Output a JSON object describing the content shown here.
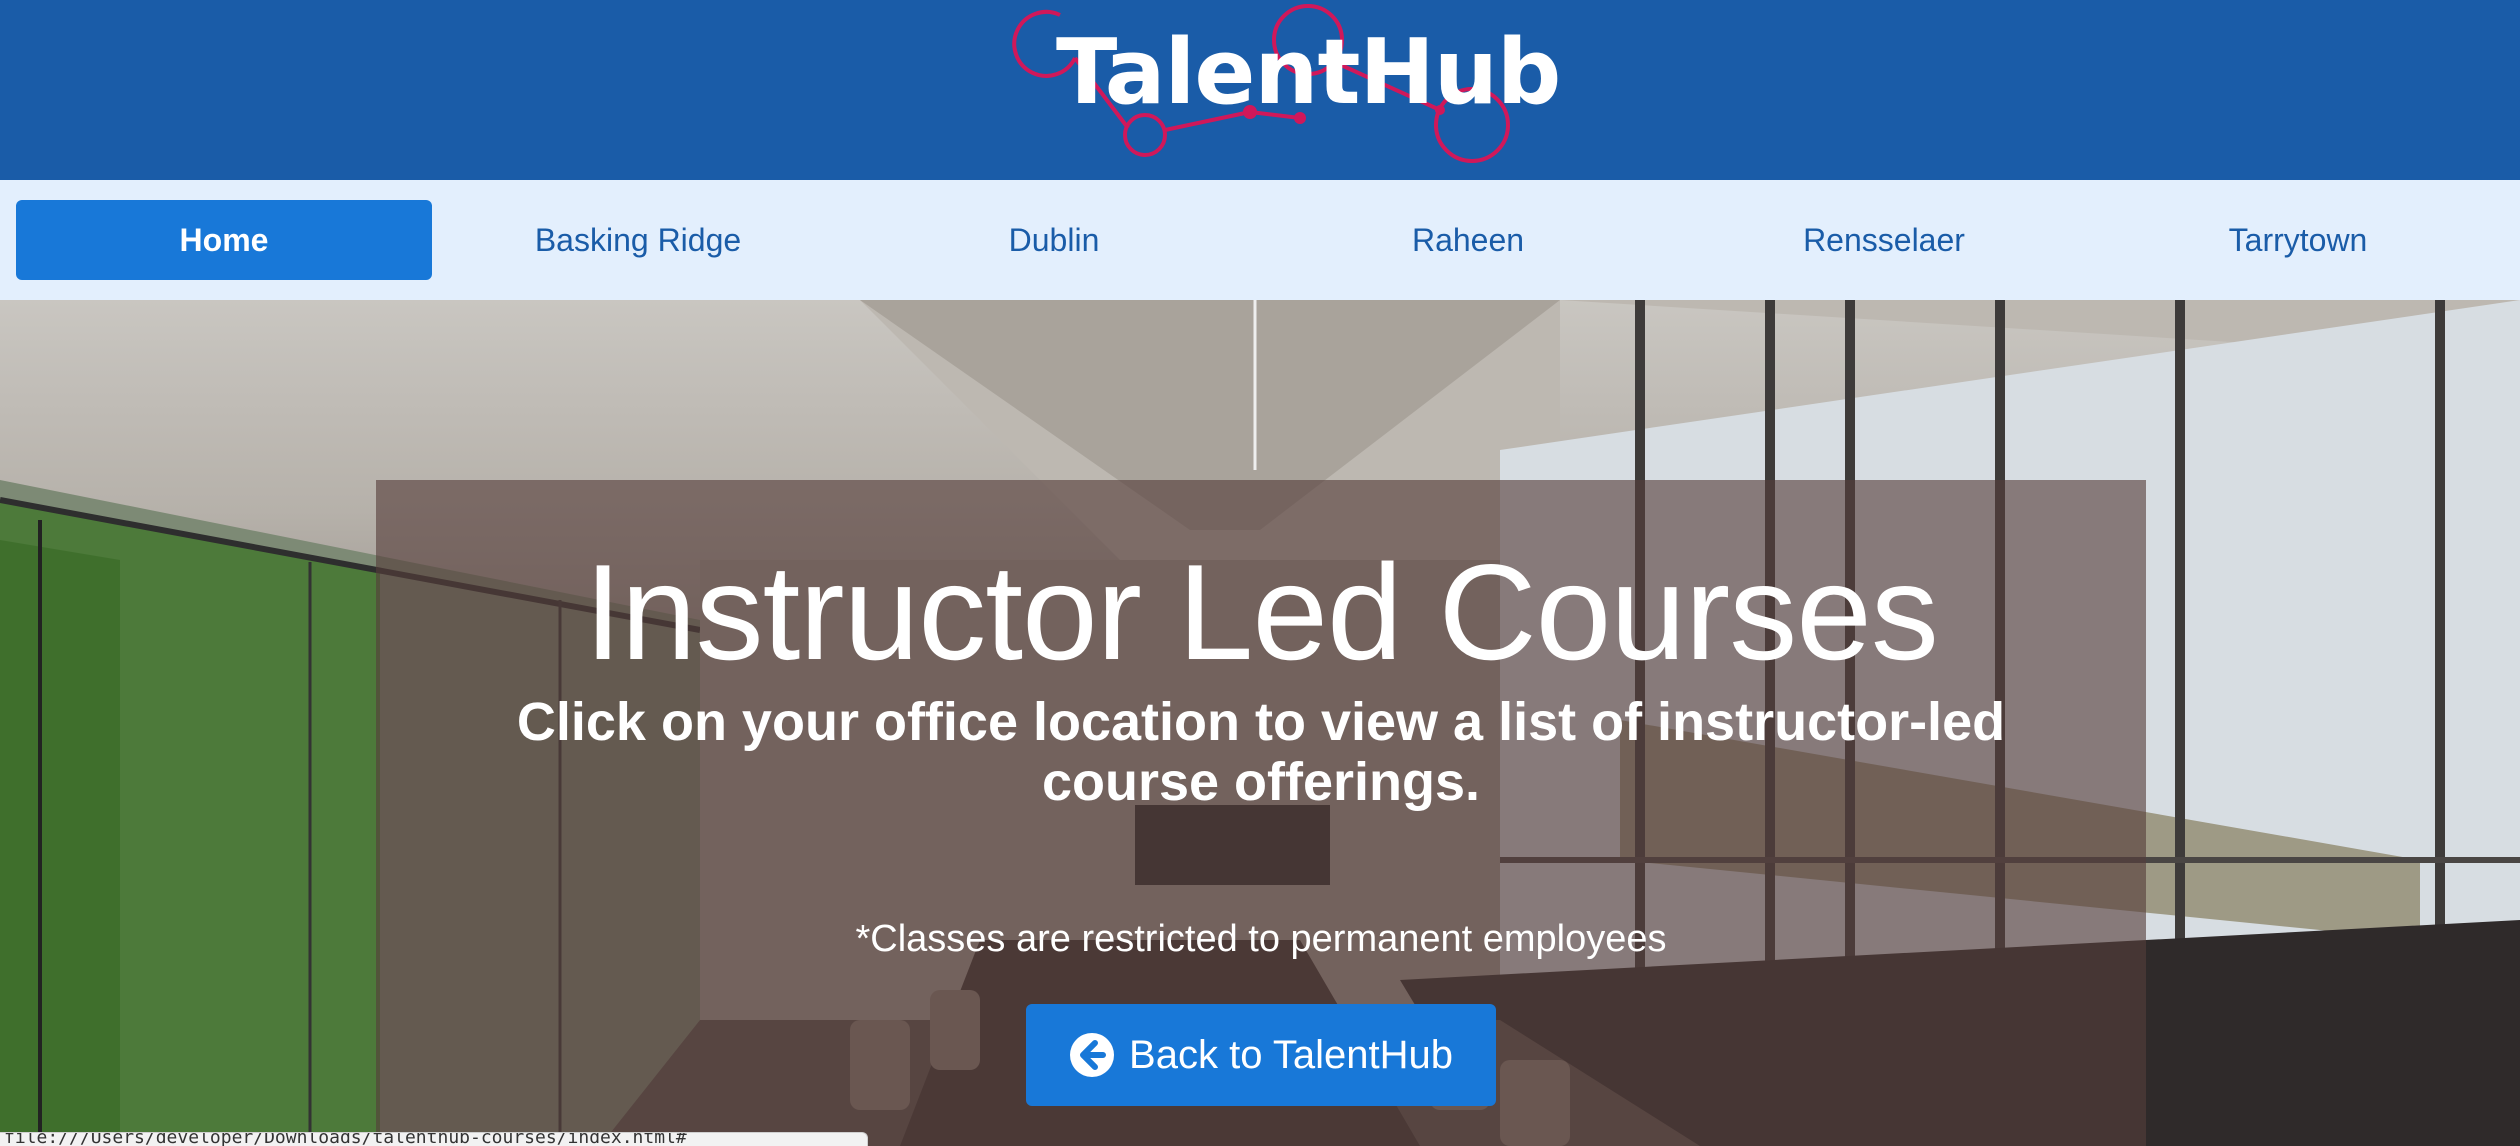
{
  "header": {
    "logo_text": "TalentHub",
    "brand_color": "#1a5ca8",
    "logo_accent_color": "#d0185a"
  },
  "nav": {
    "items": [
      {
        "label": "Home",
        "active": true
      },
      {
        "label": "Basking Ridge",
        "active": false
      },
      {
        "label": "Dublin",
        "active": false
      },
      {
        "label": "Raheen",
        "active": false
      },
      {
        "label": "Rensselaer",
        "active": false
      },
      {
        "label": "Tarrytown",
        "active": false
      }
    ],
    "active_color": "#1878d8",
    "background_color": "#e3effd"
  },
  "hero": {
    "background_image": "conference-room-photo",
    "title": "Instructor Led Courses",
    "subtitle": "Click on your office location to view a list of instructor-led course offerings.",
    "note": "*Classes are restricted to permanent employees",
    "back_button": {
      "label": "Back to TalentHub",
      "icon": "arrow-circle-left-icon"
    }
  },
  "status_bar": {
    "text": "file:///Users/developer/Downloads/talenthub-courses/index.html#"
  }
}
